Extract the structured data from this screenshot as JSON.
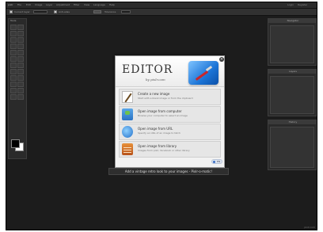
{
  "app": {
    "logo": "pixlr",
    "menu": [
      "File",
      "Edit",
      "Image",
      "Layer",
      "Adjustment",
      "Filter",
      "View",
      "Language",
      "Help"
    ],
    "right_menu": [
      "Login",
      "Register"
    ]
  },
  "optionsbar": {
    "checkbox_label": "Current layer",
    "antialias_label": "Anti-alias",
    "tolerance_label": "Tolerance",
    "contiguous_label": "Contiguous",
    "search_label": "Search"
  },
  "toolbox": {
    "title": "Tools"
  },
  "panels": {
    "navigator": "Navigator",
    "layers": "Layers",
    "history": "History"
  },
  "dialog": {
    "logo_text": "EDITOR",
    "byline": "by pixlr.com",
    "close_symbol": "×",
    "options": [
      {
        "title": "Create a new image",
        "desc": "Start with a blank image or from the clipboard",
        "icon": "brush-icon"
      },
      {
        "title": "Open image from computer",
        "desc": "Browse your computer to select an image",
        "icon": "computer-icon"
      },
      {
        "title": "Open image from URL",
        "desc": "Specify an URL of an image to fetch",
        "icon": "globe-icon"
      },
      {
        "title": "Open image from library",
        "desc": "Images from pixlr, facebook or other library",
        "icon": "library-icon"
      }
    ],
    "language": "EN"
  },
  "promo": {
    "text": "Add a vintage retro look to your images - Pixlr-o-matic!"
  },
  "status": {
    "text": "pixlr.com"
  },
  "colors": {
    "background": "#1c1c1c",
    "dialog": "#f2f2f2",
    "accent": "#1b74d6"
  }
}
